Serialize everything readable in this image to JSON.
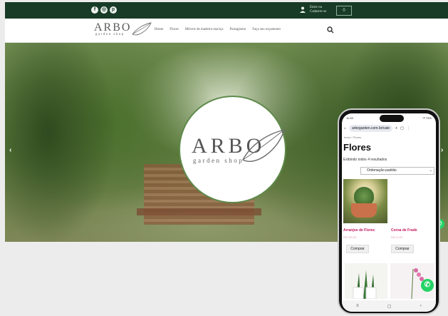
{
  "header": {
    "social_icons": [
      "facebook-icon",
      "instagram-icon",
      "pinterest-icon"
    ],
    "login_line1": "Entre ou",
    "login_line2": "Cadastre-se",
    "cart_label": "0"
  },
  "nav": {
    "logo_text": "ARBO",
    "logo_sub": "garden shop",
    "items": [
      "Home",
      "Flores",
      "Móveis de madeira maciça",
      "Paisagismo",
      "Faça seu orçamento"
    ]
  },
  "hero": {
    "logo_text": "ARBO",
    "logo_sub": "garden shop",
    "prev_arrow": "‹",
    "next_arrow": "›"
  },
  "phone": {
    "time": "11:33",
    "signal": "⁴ᴳ 72%",
    "url": "arbogarden.com.br/cate",
    "breadcrumb": "Início / Flores",
    "title": "Flores",
    "results": "Exibindo todos 4 resultados",
    "ordering": "Ordenação padrão",
    "products": [
      {
        "name": "Arranjos de Flores",
        "price": "R$ 220,00",
        "button": "Comprar"
      },
      {
        "name": "Coroa de Frade",
        "price": "R$ 23,00",
        "button": "Comprar"
      }
    ],
    "nav_icons": [
      "menu-icon",
      "home-square-icon",
      "back-icon"
    ]
  },
  "colors": {
    "topbar": "#173b26",
    "product_name": "#c2185b",
    "whatsapp": "#25d366"
  }
}
